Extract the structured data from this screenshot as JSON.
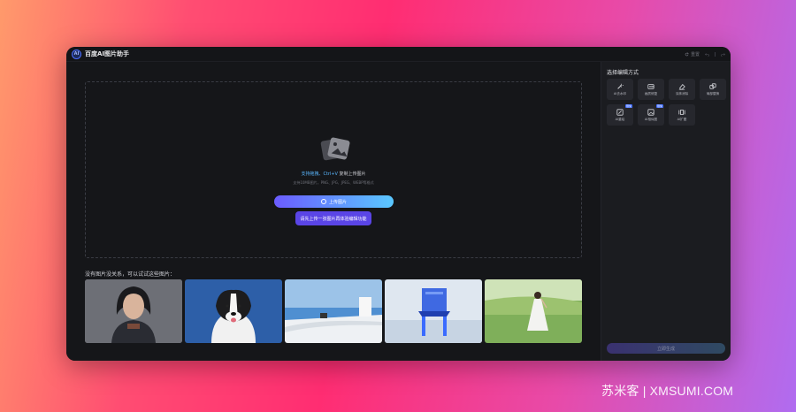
{
  "titlebar": {
    "logo_text": "AI",
    "title": "百度AI图片助手",
    "reset_label": "重置"
  },
  "dropzone": {
    "hint_accent": "支持拖拽、Ctrl+V",
    "hint_rest": " 复制上传图片",
    "formats": "支持10MB图片，PNG、JPG、JPEG、WEBP等格式",
    "upload_label": "上传图片",
    "tip_label": "请先上传一张图片再体验编辑功能"
  },
  "samples": {
    "label": "没有图片没关系，可以试试这些图片："
  },
  "sidebar": {
    "title": "选择编辑方式",
    "tools": [
      {
        "label": "AI去水印",
        "icon": "magic-wand-icon",
        "badge": ""
      },
      {
        "label": "画质修复",
        "icon": "hd-icon",
        "badge": ""
      },
      {
        "label": "涂抹消除",
        "icon": "eraser-icon",
        "badge": ""
      },
      {
        "label": "局部替换",
        "icon": "layers-icon",
        "badge": ""
      },
      {
        "label": "AI重绘",
        "icon": "redraw-icon",
        "badge": "限免"
      },
      {
        "label": "AI相似图",
        "icon": "similar-image-icon",
        "badge": "限免"
      },
      {
        "label": "AI扩图",
        "icon": "expand-icon",
        "badge": ""
      }
    ],
    "generate_label": "立即生成"
  },
  "watermark": "苏米客 | XMSUMI.COM",
  "colors": {
    "accent_blue": "#5ab7ff",
    "primary_purple": "#5a45e6",
    "window_bg": "#151619"
  }
}
